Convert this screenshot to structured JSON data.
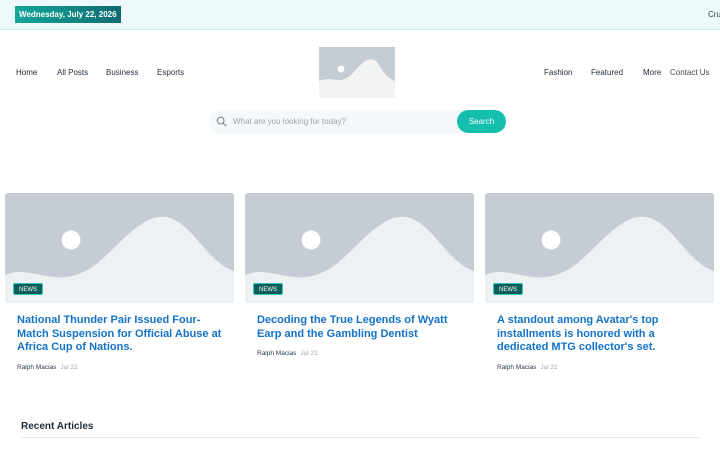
{
  "topbar": {
    "date": "Wednesday, July 22, 2026",
    "ticker": "Cru"
  },
  "nav": {
    "left": [
      "Home",
      "All Posts",
      "Business",
      "Esports"
    ],
    "right": [
      "Fashion",
      "Featured",
      "More",
      "Contact Us"
    ]
  },
  "search": {
    "placeholder": "What are you looking for today?",
    "button": "Search"
  },
  "cards": [
    {
      "badge": "NEWS",
      "title": "National Thunder Pair Issued Four-Match Suspension for Official Abuse at Africa Cup of Nations.",
      "author": "Ralph Macias",
      "date": "Jul 22"
    },
    {
      "badge": "NEWS",
      "title": "Decoding the True Legends of Wyatt Earp and the Gambling Dentist",
      "author": "Ralph Macias",
      "date": "Jul 21"
    },
    {
      "badge": "NEWS",
      "title": "A standout among Avatar's top installments is honored with a dedicated MTG collector's set.",
      "author": "Ralph Macias",
      "date": "Jul 21"
    }
  ],
  "recent": {
    "heading": "Recent Articles"
  },
  "colors": {
    "accent": "#14bfae",
    "link": "#1473c6",
    "badge": "#0e5c5a"
  }
}
